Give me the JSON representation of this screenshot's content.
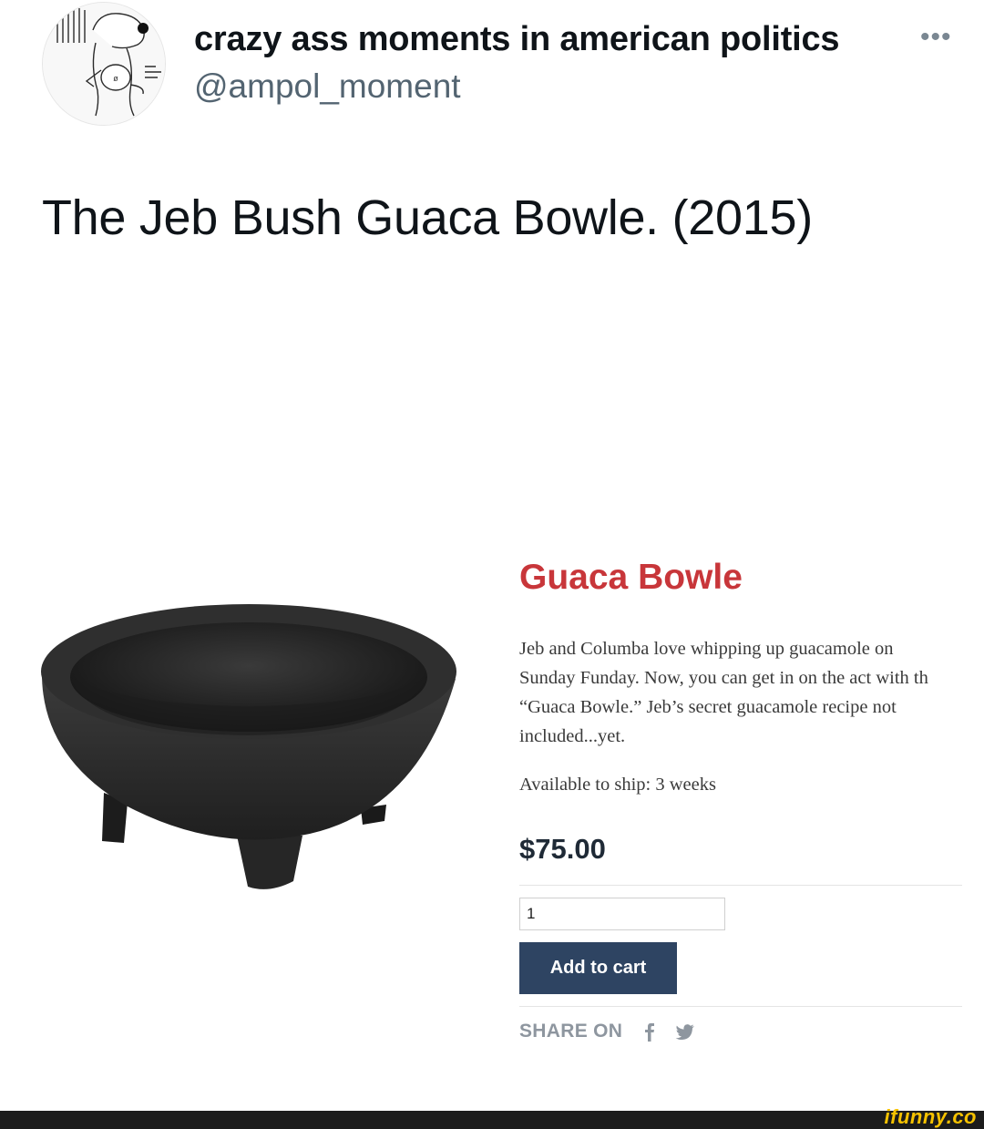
{
  "tweet": {
    "display_name": "crazy ass moments in american politics",
    "handle": "@ampol_moment",
    "more_icon": "ellipsis-icon",
    "text": "The Jeb Bush Guaca Bowle. (2015)"
  },
  "product": {
    "title": "Guaca Bowle",
    "description_lines": [
      "Jeb and Columba love whipping up guacamole on",
      "Sunday Funday. Now, you can get in on the act with th",
      "“Guaca Bowle.” Jeb’s secret guacamole recipe not",
      "included...yet."
    ],
    "shipping": "Available to ship: 3 weeks",
    "price": "$75.00",
    "quantity_value": "1",
    "add_to_cart_label": "Add to cart",
    "share_label": "SHARE ON",
    "share_icons": [
      "facebook-icon",
      "twitter-icon"
    ],
    "title_color": "#c8363a",
    "button_color": "#2e4462"
  },
  "watermark": {
    "text": "ifunny.co"
  }
}
